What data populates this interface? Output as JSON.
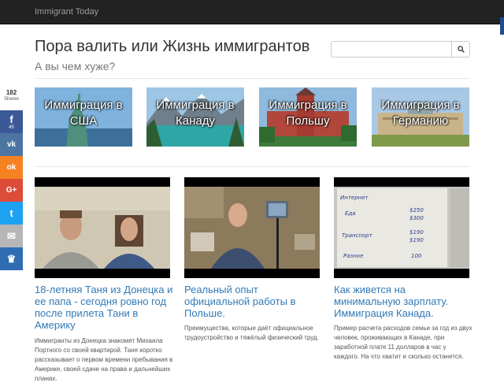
{
  "navbar": {
    "brand": "Immigrant Today"
  },
  "header": {
    "title": "Пора валить или Жизнь иммигрантов",
    "subtitle": "А вы чем хуже?",
    "search": {
      "placeholder": ""
    }
  },
  "share": {
    "count": "182",
    "count_label": "Shares",
    "buttons": [
      {
        "network": "facebook",
        "icon": "facebook-icon",
        "glyph": "f",
        "sub": "45",
        "color": "#3b5998"
      },
      {
        "network": "vkontakte",
        "icon": "vk-icon",
        "glyph": "vk",
        "sub": "",
        "color": "#4c75a3"
      },
      {
        "network": "odnoklassniki",
        "icon": "odnoklassniki-icon",
        "glyph": "ok",
        "sub": "",
        "color": "#f58220"
      },
      {
        "network": "google-plus",
        "icon": "google-plus-icon",
        "glyph": "G+",
        "sub": "",
        "color": "#dd4b39"
      },
      {
        "network": "twitter",
        "icon": "twitter-icon",
        "glyph": "t",
        "sub": "",
        "color": "#1da1f2"
      },
      {
        "network": "email",
        "icon": "mail-icon",
        "glyph": "✉",
        "sub": "",
        "color": "#b6b6b6"
      },
      {
        "network": "crown",
        "icon": "crown-icon",
        "glyph": "♛",
        "sub": "",
        "color": "#2f6db3"
      }
    ]
  },
  "categories": [
    {
      "label": "Иммиграция в США"
    },
    {
      "label": "Иммиграция в Канаду"
    },
    {
      "label": "Иммиграция в Польшу"
    },
    {
      "label": "Иммиграция в Германию"
    }
  ],
  "posts": [
    {
      "title": "18-летняя Таня из Донецка и ее папа - сегодня ровно год после прилета Тани в Америку",
      "excerpt": "Иммигранты из Донецка знакомят Михаила Портного со своей квартирой. Таня коротко рассказывает о первом времени пребывания в Америке, своей сдаче на права и дальнейших планах."
    },
    {
      "title": "Реальный опыт официальной работы в Польше.",
      "excerpt": "Преимущества, которые даёт официальное трудоустройство и тяжёлый физический труд."
    },
    {
      "title": "Как живется на минимальную зарплату. Иммиграция Канада.",
      "excerpt": "Пример расчета расходов семьи за год из двух человек, проживающих в Канаде, при заработной плате 11 долларов в час у каждого. На что хватит и сколько останется.",
      "note_lines": [
        "Интернет",
        "Еда",
        "Транспорт",
        "Разное",
        "$250",
        "$300",
        "$190",
        "$190",
        "100"
      ]
    }
  ]
}
